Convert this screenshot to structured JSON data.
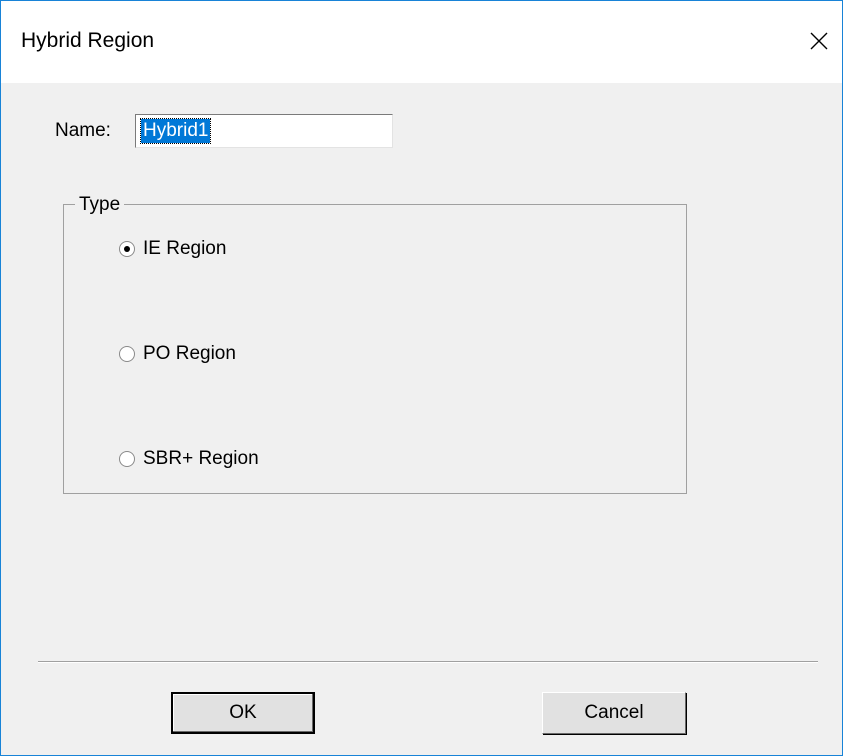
{
  "window": {
    "title": "Hybrid Region",
    "close_icon": "close-icon"
  },
  "name_field": {
    "label": "Name:",
    "value": "Hybrid1"
  },
  "type_group": {
    "legend": "Type",
    "options": [
      {
        "label": "IE Region",
        "checked": true
      },
      {
        "label": "PO Region",
        "checked": false
      },
      {
        "label": "SBR+ Region",
        "checked": false
      }
    ]
  },
  "buttons": {
    "ok_label": "OK",
    "cancel_label": "Cancel"
  },
  "colors": {
    "window_border": "#1883d7",
    "selection": "#0078d7",
    "dialog_bg": "#f0f0f0"
  }
}
